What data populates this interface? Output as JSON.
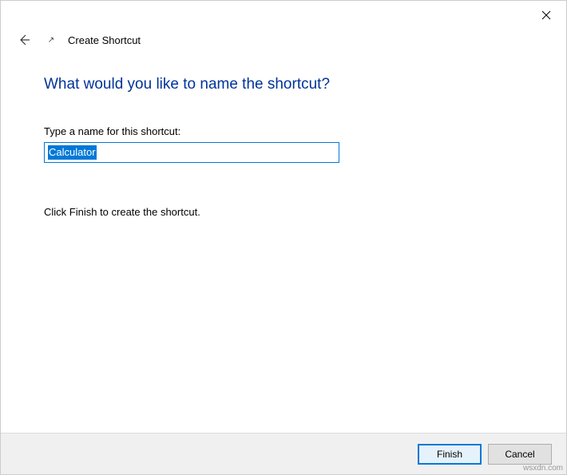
{
  "titlebar": {
    "close_tooltip": "Close"
  },
  "header": {
    "back_tooltip": "Back",
    "shortcut_icon_symbol": "↗",
    "page_title": "Create Shortcut"
  },
  "content": {
    "heading": "What would you like to name the shortcut?",
    "field_label": "Type a name for this shortcut:",
    "field_value": "Calculator",
    "instruction": "Click Finish to create the shortcut."
  },
  "footer": {
    "finish_label": "Finish",
    "cancel_label": "Cancel"
  },
  "watermark": "wsxdn.com"
}
